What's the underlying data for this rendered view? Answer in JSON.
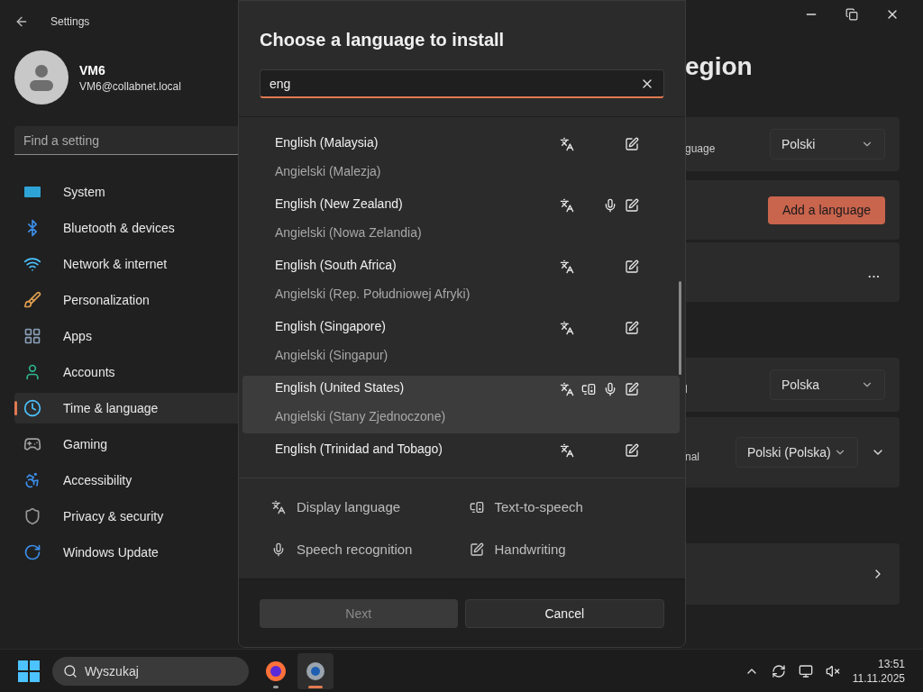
{
  "window": {
    "title": "Settings"
  },
  "user": {
    "name": "VM6",
    "email": "VM6@collabnet.local"
  },
  "sidebar": {
    "search": {
      "placeholder": "Find a setting"
    },
    "items": [
      {
        "label": "System",
        "kind": "system",
        "selected": false
      },
      {
        "label": "Bluetooth & devices",
        "kind": "bluetooth",
        "selected": false
      },
      {
        "label": "Network & internet",
        "kind": "network",
        "selected": false
      },
      {
        "label": "Personalization",
        "kind": "brush",
        "selected": false
      },
      {
        "label": "Apps",
        "kind": "apps",
        "selected": false
      },
      {
        "label": "Accounts",
        "kind": "accounts",
        "selected": false
      },
      {
        "label": "Time & language",
        "kind": "time",
        "selected": true
      },
      {
        "label": "Gaming",
        "kind": "gaming",
        "selected": false
      },
      {
        "label": "Accessibility",
        "kind": "accessibility",
        "selected": false
      },
      {
        "label": "Privacy & security",
        "kind": "privacy",
        "selected": false
      },
      {
        "label": "Windows Update",
        "kind": "update",
        "selected": false
      }
    ]
  },
  "main": {
    "title": "egion",
    "cards": [
      {
        "kind": "dropdown",
        "label": "guage",
        "value": "Polski"
      },
      {
        "kind": "button",
        "button": "Add a language"
      },
      {
        "kind": "more",
        "button": "..."
      },
      {
        "kind": "dropdown",
        "label": "l",
        "value": "Polska"
      },
      {
        "kind": "dropdown_expand",
        "label": "nal",
        "value": "Polski (Polska)"
      },
      {
        "kind": "link"
      }
    ]
  },
  "dialog": {
    "title": "Choose a language to install",
    "search": {
      "value": "eng"
    },
    "languages": [
      {
        "name": "English (Malaysia)",
        "native": "Angielski (Malezja)",
        "display": true,
        "tts": false,
        "speech": false,
        "handwriting": true,
        "highlighted": false
      },
      {
        "name": "English (New Zealand)",
        "native": "Angielski (Nowa Zelandia)",
        "display": true,
        "tts": false,
        "speech": true,
        "handwriting": true,
        "highlighted": false
      },
      {
        "name": "English (South Africa)",
        "native": "Angielski (Rep. Południowej Afryki)",
        "display": true,
        "tts": false,
        "speech": false,
        "handwriting": true,
        "highlighted": false
      },
      {
        "name": "English (Singapore)",
        "native": "Angielski (Singapur)",
        "display": true,
        "tts": false,
        "speech": false,
        "handwriting": true,
        "highlighted": false
      },
      {
        "name": "English (United States)",
        "native": "Angielski (Stany Zjednoczone)",
        "display": true,
        "tts": true,
        "speech": true,
        "handwriting": true,
        "highlighted": true
      },
      {
        "name": "English (Trinidad and Tobago)",
        "display": true,
        "tts": false,
        "speech": false,
        "handwriting": true,
        "highlighted": false
      }
    ],
    "legend": [
      {
        "kind": "display",
        "label": "Display language"
      },
      {
        "kind": "tts",
        "label": "Text-to-speech"
      },
      {
        "kind": "speech",
        "label": "Speech recognition"
      },
      {
        "kind": "handwriting",
        "label": "Handwriting"
      }
    ],
    "buttons": [
      {
        "label": "Next",
        "disabled": true
      },
      {
        "label": "Cancel",
        "disabled": false
      }
    ]
  },
  "taskbar": {
    "search": {
      "placeholder": "Wyszukaj"
    },
    "apps": [
      {
        "kind": "firefox",
        "active": false
      },
      {
        "kind": "settings",
        "active": true
      }
    ],
    "time": "13:51",
    "date": "11.11.2025"
  }
}
